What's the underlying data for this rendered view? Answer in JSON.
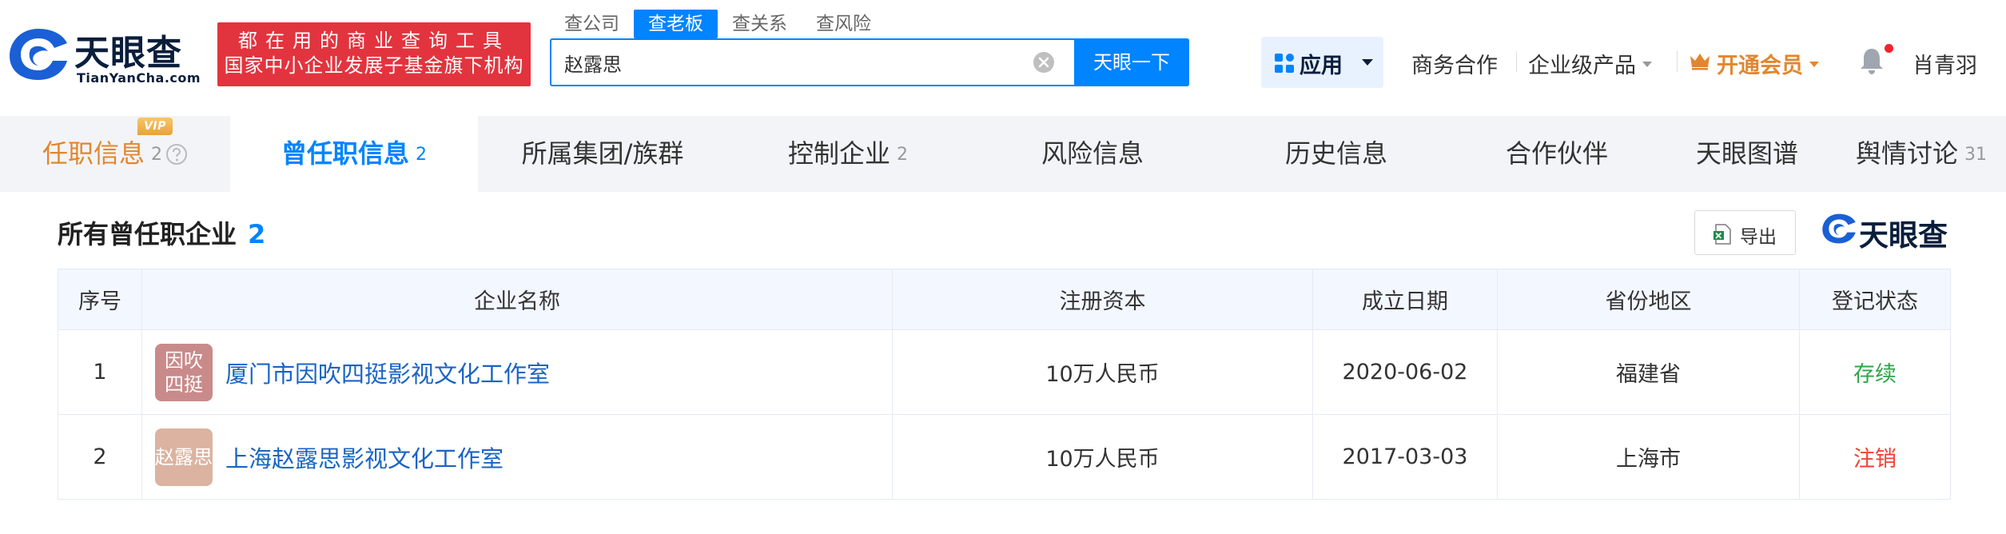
{
  "header": {
    "logo_text": "天眼查",
    "logo_sub": "TianYanCha.com",
    "slogan_line1": "都在用的商业查询工具",
    "slogan_line2": "国家中小企业发展子基金旗下机构",
    "search_tabs": [
      {
        "label": "查公司",
        "active": false
      },
      {
        "label": "查老板",
        "active": true
      },
      {
        "label": "查关系",
        "active": false
      },
      {
        "label": "查风险",
        "active": false
      }
    ],
    "search_value": "赵露思",
    "search_button": "天眼一下",
    "apps_label": "应用",
    "nav_business": "商务合作",
    "nav_enterprise": "企业级产品",
    "nav_vip": "开通会员",
    "user_name": "肖青羽"
  },
  "tabs": [
    {
      "label": "任职信息",
      "count": "2",
      "vip_badge": "VIP"
    },
    {
      "label": "曾任职信息",
      "count": "2"
    },
    {
      "label": "所属集团/族群",
      "count": ""
    },
    {
      "label": "控制企业",
      "count": "2"
    },
    {
      "label": "风险信息",
      "count": ""
    },
    {
      "label": "历史信息",
      "count": ""
    },
    {
      "label": "合作伙伴",
      "count": ""
    },
    {
      "label": "天眼图谱",
      "count": ""
    },
    {
      "label": "舆情讨论",
      "count": "31"
    }
  ],
  "section": {
    "title": "所有曾任职企业",
    "count": "2",
    "export_label": "导出",
    "brand_text": "天眼查"
  },
  "table": {
    "columns": [
      "序号",
      "企业名称",
      "注册资本",
      "成立日期",
      "省份地区",
      "登记状态"
    ],
    "rows": [
      {
        "index": "1",
        "logo_line1": "因吹",
        "logo_line2": "四挺",
        "logo_color": "#c98a8a",
        "name": "厦门市因吹四挺影视文化工作室",
        "capital": "10万人民币",
        "date": "2020-06-02",
        "region": "福建省",
        "status": "存续",
        "status_color": "#31a54a"
      },
      {
        "index": "2",
        "logo_line1": "赵露思",
        "logo_line2": "",
        "logo_color": "#dbb3a0",
        "name": "上海赵露思影视文化工作室",
        "capital": "10万人民币",
        "date": "2017-03-03",
        "region": "上海市",
        "status": "注销",
        "status_color": "#f04134"
      }
    ]
  },
  "colors": {
    "primary": "#0084ff",
    "brand_red": "#e2343e",
    "vip_gold": "#e2862e",
    "tab_bg": "#f3f4f8"
  }
}
